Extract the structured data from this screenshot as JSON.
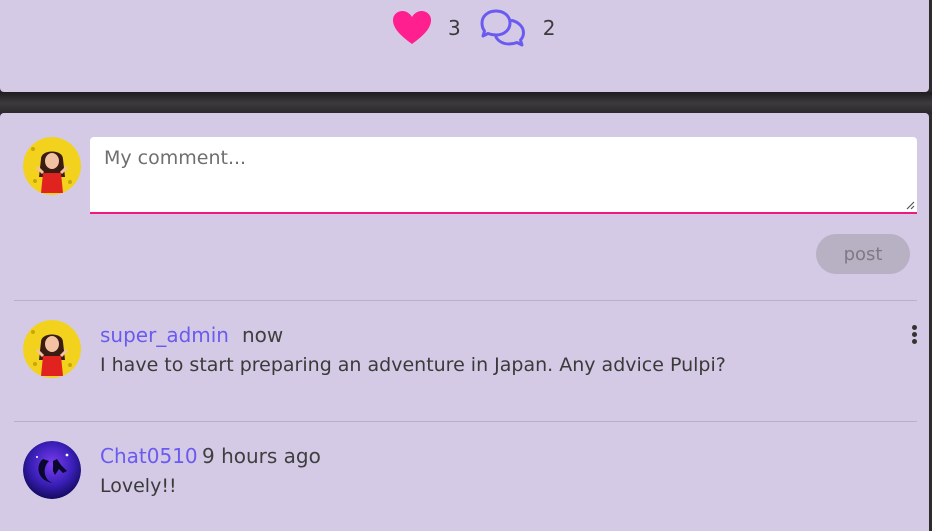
{
  "reactions": {
    "likes_count": "3",
    "comments_count": "2",
    "heart_color": "#ff1f8e",
    "comment_icon_color": "#6a5bf0"
  },
  "composer": {
    "placeholder": "My comment...",
    "post_label": "post"
  },
  "comments": [
    {
      "author": "super_admin",
      "time": "now",
      "text": "I have to start preparing an adventure in Japan. Any advice Pulpi?"
    },
    {
      "author": "Chat0510",
      "time": "9 hours ago",
      "text": "Lovely!!"
    }
  ]
}
